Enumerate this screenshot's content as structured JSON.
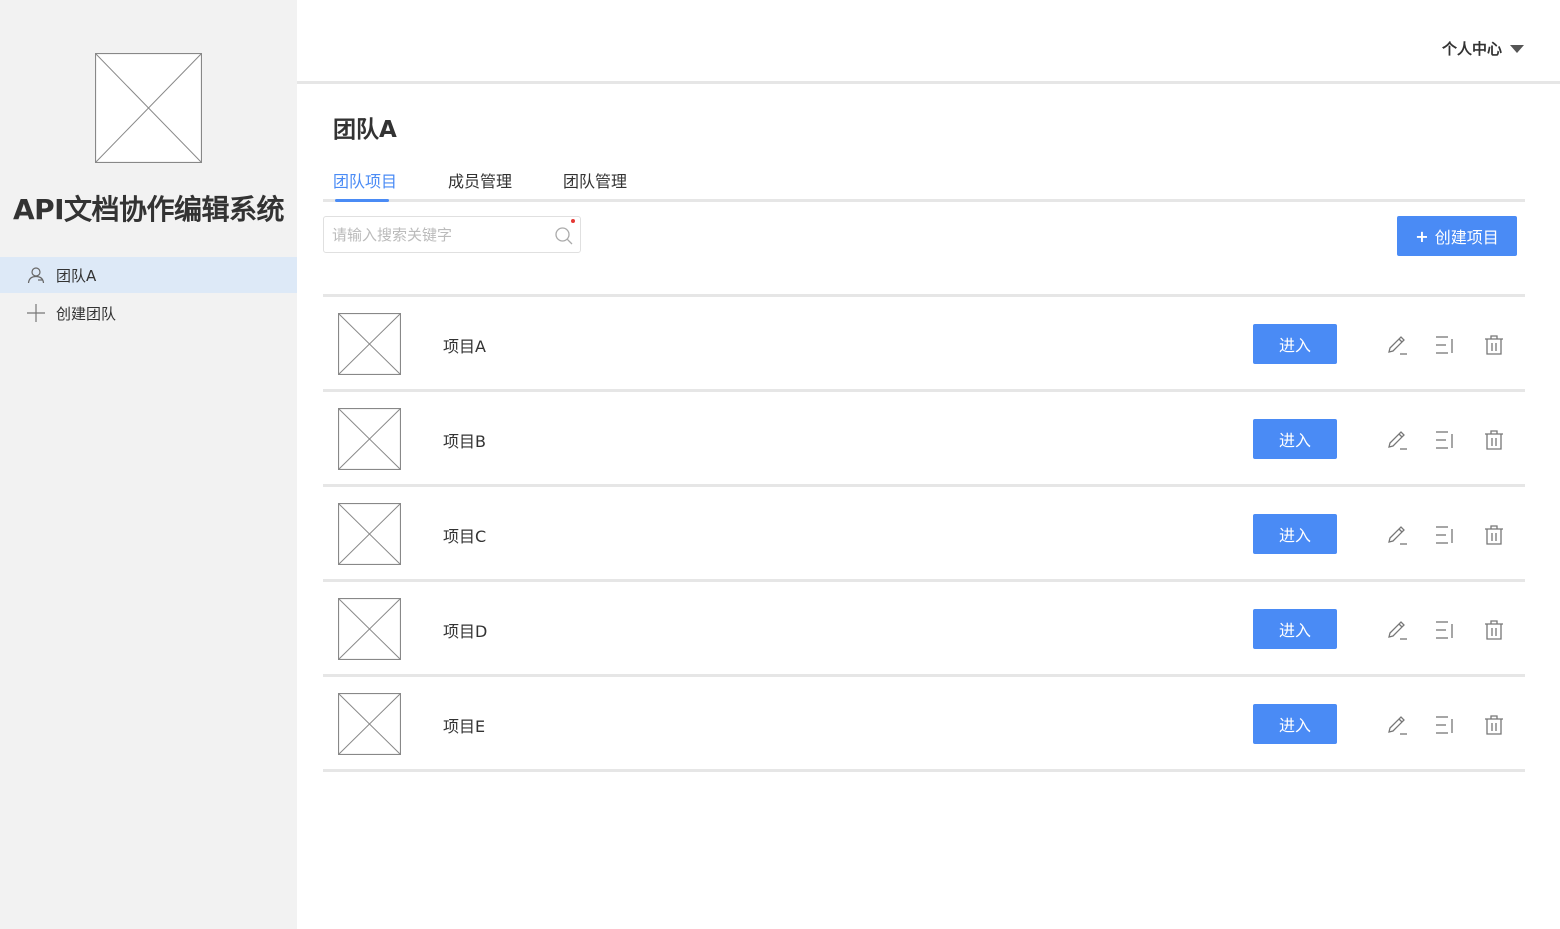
{
  "sidebar": {
    "app_title": "API文档协作编辑系统",
    "items": [
      {
        "label": "团队A",
        "icon": "user-icon",
        "active": true
      },
      {
        "label": "创建团队",
        "icon": "plus-icon",
        "active": false
      }
    ]
  },
  "header": {
    "user_menu_label": "个人中心",
    "user_menu_icon": "caret-down-icon"
  },
  "main": {
    "title": "团队A",
    "tabs": [
      {
        "label": "团队项目",
        "active": true
      },
      {
        "label": "成员管理",
        "active": false
      },
      {
        "label": "团队管理",
        "active": false
      }
    ],
    "search": {
      "placeholder": "请输入搜索关键字",
      "value": "",
      "icon": "search-icon"
    },
    "create_button_label": "创建项目",
    "create_button_icon": "+",
    "projects": [
      {
        "name": "项目A",
        "enter_label": "进入"
      },
      {
        "name": "项目B",
        "enter_label": "进入"
      },
      {
        "name": "项目C",
        "enter_label": "进入"
      },
      {
        "name": "项目D",
        "enter_label": "进入"
      },
      {
        "name": "项目E",
        "enter_label": "进入"
      }
    ],
    "row_actions": [
      "edit-icon",
      "sort-icon",
      "trash-icon"
    ]
  },
  "colors": {
    "accent": "#4a8bf5",
    "sidebar_bg": "#f2f2f2",
    "active_item_bg": "#dde9f7",
    "divider": "#e6e6e6"
  }
}
